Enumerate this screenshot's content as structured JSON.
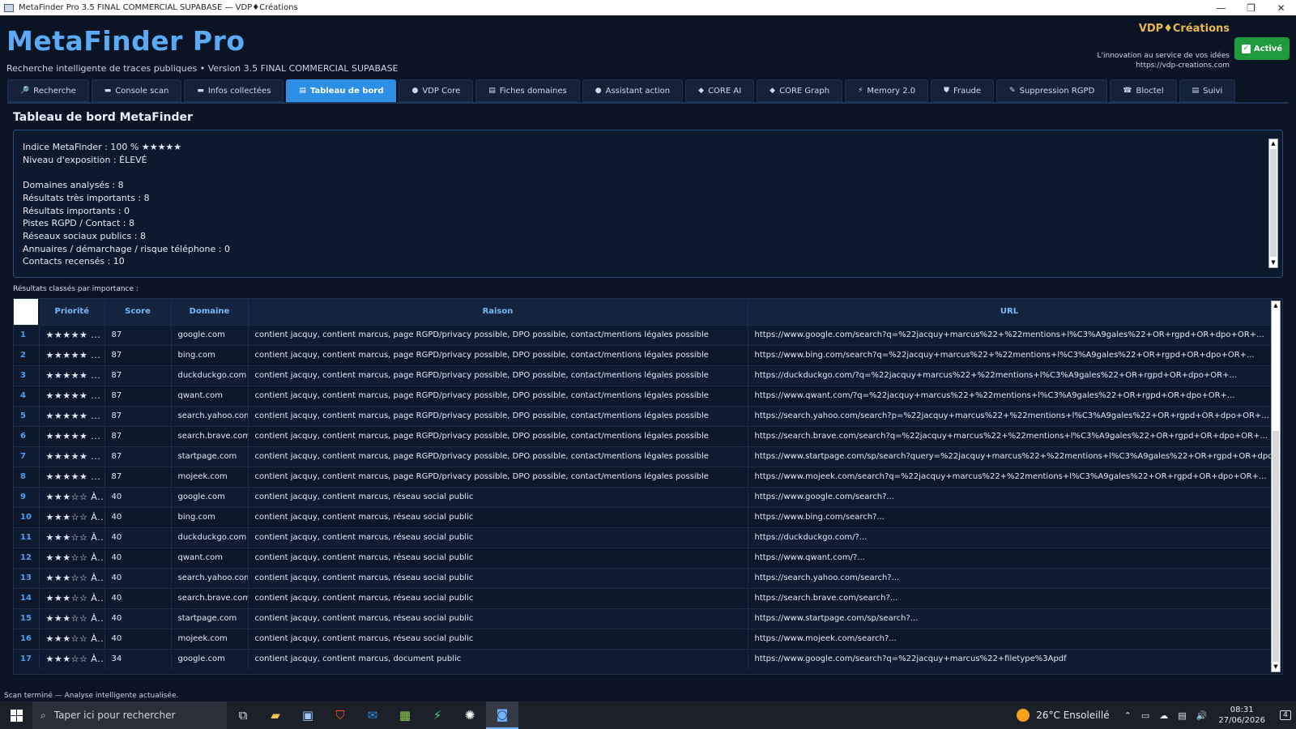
{
  "window": {
    "title": "MetaFinder Pro 3.5 FINAL COMMERCIAL SUPABASE — VDP♦Créations",
    "minimize": "—",
    "maximize": "❐",
    "close": "✕"
  },
  "header": {
    "app_title": "MetaFinder Pro",
    "subtitle": "Recherche intelligente de traces publiques • Version 3.5 FINAL COMMERCIAL SUPABASE",
    "brand": "VDP♦Créations",
    "tagline": "L'innovation au service de vos idées",
    "website": "https://vdp-creations.com",
    "status_badge": "Activé"
  },
  "tabs": [
    {
      "label": "Recherche",
      "icon": "🔎"
    },
    {
      "label": "Console scan",
      "icon": "▬"
    },
    {
      "label": "Infos collectées",
      "icon": "▬"
    },
    {
      "label": "Tableau de bord",
      "icon": "▤",
      "active": true
    },
    {
      "label": "VDP Core",
      "icon": "●"
    },
    {
      "label": "Fiches domaines",
      "icon": "▤"
    },
    {
      "label": "Assistant action",
      "icon": "●"
    },
    {
      "label": "CORE AI",
      "icon": "◆"
    },
    {
      "label": "CORE Graph",
      "icon": "◆"
    },
    {
      "label": "Memory 2.0",
      "icon": "⚡"
    },
    {
      "label": "Fraude",
      "icon": "⛊"
    },
    {
      "label": "Suppression RGPD",
      "icon": "✎"
    },
    {
      "label": "Bloctel",
      "icon": "☎"
    },
    {
      "label": "Suivi",
      "icon": "▤"
    }
  ],
  "dashboard": {
    "title": "Tableau de bord MetaFinder",
    "index_line": "Indice MetaFinder : 100 %  ★★★★★",
    "exposure": "Niveau d'exposition : ÉLEVÉ",
    "stats": [
      "Domaines analysés : 8",
      "Résultats très importants : 8",
      "Résultats importants : 0",
      "Pistes RGPD / Contact : 8",
      "Réseaux sociaux publics : 8",
      "Annuaires / démarchage / risque téléphone : 0",
      "Contacts recensés : 10"
    ],
    "results_label": "Résultats classés par importance :"
  },
  "table": {
    "columns": [
      "",
      "Priorité",
      "Score",
      "Domaine",
      "Raison",
      "URL"
    ],
    "rows": [
      [
        "1",
        "★★★★★ ...",
        "87",
        "google.com",
        "contient jacquy, contient marcus, page RGPD/privacy possible, DPO possible, contact/mentions légales possible",
        "https://www.google.com/search?q=%22jacquy+marcus%22+%22mentions+l%C3%A9gales%22+OR+rgpd+OR+dpo+OR+..."
      ],
      [
        "2",
        "★★★★★ ...",
        "87",
        "bing.com",
        "contient jacquy, contient marcus, page RGPD/privacy possible, DPO possible, contact/mentions légales possible",
        "https://www.bing.com/search?q=%22jacquy+marcus%22+%22mentions+l%C3%A9gales%22+OR+rgpd+OR+dpo+OR+..."
      ],
      [
        "3",
        "★★★★★ ...",
        "87",
        "duckduckgo.com",
        "contient jacquy, contient marcus, page RGPD/privacy possible, DPO possible, contact/mentions légales possible",
        "https://duckduckgo.com/?q=%22jacquy+marcus%22+%22mentions+l%C3%A9gales%22+OR+rgpd+OR+dpo+OR+..."
      ],
      [
        "4",
        "★★★★★ ...",
        "87",
        "qwant.com",
        "contient jacquy, contient marcus, page RGPD/privacy possible, DPO possible, contact/mentions légales possible",
        "https://www.qwant.com/?q=%22jacquy+marcus%22+%22mentions+l%C3%A9gales%22+OR+rgpd+OR+dpo+OR+..."
      ],
      [
        "5",
        "★★★★★ ...",
        "87",
        "search.yahoo.com",
        "contient jacquy, contient marcus, page RGPD/privacy possible, DPO possible, contact/mentions légales possible",
        "https://search.yahoo.com/search?p=%22jacquy+marcus%22+%22mentions+l%C3%A9gales%22+OR+rgpd+OR+dpo+OR+..."
      ],
      [
        "6",
        "★★★★★ ...",
        "87",
        "search.brave.com",
        "contient jacquy, contient marcus, page RGPD/privacy possible, DPO possible, contact/mentions légales possible",
        "https://search.brave.com/search?q=%22jacquy+marcus%22+%22mentions+l%C3%A9gales%22+OR+rgpd+OR+dpo+OR+..."
      ],
      [
        "7",
        "★★★★★ ...",
        "87",
        "startpage.com",
        "contient jacquy, contient marcus, page RGPD/privacy possible, DPO possible, contact/mentions légales possible",
        "https://www.startpage.com/sp/search?query=%22jacquy+marcus%22+%22mentions+l%C3%A9gales%22+OR+rgpd+OR+dpo+OR+..."
      ],
      [
        "8",
        "★★★★★ ...",
        "87",
        "mojeek.com",
        "contient jacquy, contient marcus, page RGPD/privacy possible, DPO possible, contact/mentions légales possible",
        "https://www.mojeek.com/search?q=%22jacquy+marcus%22+%22mentions+l%C3%A9gales%22+OR+rgpd+OR+dpo+OR+..."
      ],
      [
        "9",
        "★★★☆☆ À...",
        "40",
        "google.com",
        "contient jacquy, contient marcus, réseau social public",
        "https://www.google.com/search?..."
      ],
      [
        "10",
        "★★★☆☆ À...",
        "40",
        "bing.com",
        "contient jacquy, contient marcus, réseau social public",
        "https://www.bing.com/search?..."
      ],
      [
        "11",
        "★★★☆☆ À...",
        "40",
        "duckduckgo.com",
        "contient jacquy, contient marcus, réseau social public",
        "https://duckduckgo.com/?..."
      ],
      [
        "12",
        "★★★☆☆ À...",
        "40",
        "qwant.com",
        "contient jacquy, contient marcus, réseau social public",
        "https://www.qwant.com/?..."
      ],
      [
        "13",
        "★★★☆☆ À...",
        "40",
        "search.yahoo.com",
        "contient jacquy, contient marcus, réseau social public",
        "https://search.yahoo.com/search?..."
      ],
      [
        "14",
        "★★★☆☆ À...",
        "40",
        "search.brave.com",
        "contient jacquy, contient marcus, réseau social public",
        "https://search.brave.com/search?..."
      ],
      [
        "15",
        "★★★☆☆ À...",
        "40",
        "startpage.com",
        "contient jacquy, contient marcus, réseau social public",
        "https://www.startpage.com/sp/search?..."
      ],
      [
        "16",
        "★★★☆☆ À...",
        "40",
        "mojeek.com",
        "contient jacquy, contient marcus, réseau social public",
        "https://www.mojeek.com/search?..."
      ],
      [
        "17",
        "★★★☆☆ À...",
        "34",
        "google.com",
        "contient jacquy, contient marcus, document public",
        "https://www.google.com/search?q=%22jacquy+marcus%22+filetype%3Apdf"
      ]
    ]
  },
  "status_bar": "Scan terminé — Analyse intelligente actualisée.",
  "taskbar": {
    "search_placeholder": "Taper ici pour rechercher",
    "weather": "26°C  Ensoleillé",
    "time": "08:31",
    "date": "27/06/2026",
    "notification_count": "4",
    "apps": [
      "task-view-icon",
      "file-explorer-icon",
      "store-icon",
      "brave-browser-icon",
      "outlook-icon",
      "photos-icon",
      "bolt-app-icon",
      "chatgpt-icon",
      "metafinder-app-icon"
    ]
  },
  "colors": {
    "background": "#0b1424",
    "accent": "#2d8ee6",
    "title": "#5aaaf5",
    "brand": "#e7b84a",
    "active_badge": "#1f9a3c"
  }
}
